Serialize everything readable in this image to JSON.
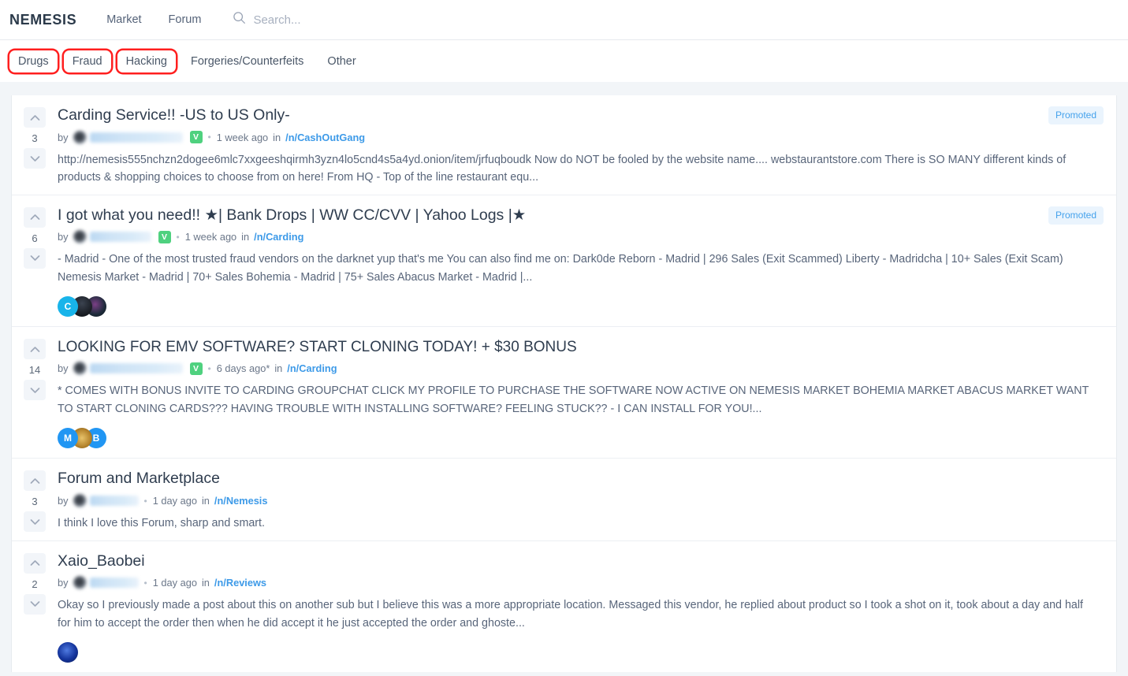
{
  "header": {
    "brand": "NEMESIS",
    "nav": [
      {
        "label": "Market",
        "name": "nav-market"
      },
      {
        "label": "Forum",
        "name": "nav-forum"
      }
    ],
    "search": {
      "placeholder": "Search...",
      "value": "",
      "icon": "search-icon"
    }
  },
  "categories": [
    {
      "label": "Drugs",
      "highlighted": true
    },
    {
      "label": "Fraud",
      "highlighted": true
    },
    {
      "label": "Hacking",
      "highlighted": true
    },
    {
      "label": "Forgeries/Counterfeits",
      "highlighted": false
    },
    {
      "label": "Other",
      "highlighted": false
    }
  ],
  "colors": {
    "accent_link": "#3d9ae8",
    "verified_badge": "#4fd17f",
    "promoted_bg": "#eaf4fd",
    "promoted_text": "#45a2ec",
    "highlight_outline": "#ff1f1f",
    "page_bg": "#f2f5f8"
  },
  "posts": [
    {
      "score": "3",
      "title": "Carding Service!! -US to US Only-",
      "by_label": "by",
      "author_redacted": true,
      "verified": true,
      "verified_label": "V",
      "separator": "•",
      "age": "1 week ago",
      "in_label": "in",
      "sub": "/n/CashOutGang",
      "excerpt": "http://nemesis555nchzn2dogee6mlc7xxgeeshqirmh3yzn4lo5cnd4s5a4yd.onion/item/jrfuqboudk Now do NOT be fooled by the website name.... webstaurantstore.com There is SO MANY different kinds of products & shopping choices to choose from on here! From HQ - Top of the line restaurant equ...",
      "promoted": true,
      "promoted_label": "Promoted",
      "avatars": []
    },
    {
      "score": "6",
      "title": "I got what you need!! ★| Bank Drops | WW CC/CVV | Yahoo Logs |★",
      "by_label": "by",
      "author_redacted": true,
      "verified": true,
      "verified_label": "V",
      "separator": "•",
      "age": "1 week ago",
      "in_label": "in",
      "sub": "/n/Carding",
      "excerpt": "- Madrid - One of the most trusted fraud vendors on the darknet yup that's me You can also find me on: Dark0de Reborn - Madrid | 296 Sales (Exit Scammed) Liberty - Madridcha | 10+ Sales (Exit Scam) Nemesis Market - Madrid | 70+ Sales Bohemia - Madrid | 75+ Sales Abacus Market - Madrid |...",
      "promoted": true,
      "promoted_label": "Promoted",
      "avatars": [
        {
          "letter": "C",
          "style": "cyan"
        },
        {
          "letter": "",
          "style": "dark"
        },
        {
          "letter": "",
          "style": "purple"
        }
      ]
    },
    {
      "score": "14",
      "title": "LOOKING FOR EMV SOFTWARE? START CLONING TODAY! + $30 BONUS",
      "by_label": "by",
      "author_redacted": true,
      "verified": true,
      "verified_label": "V",
      "separator": "•",
      "age": "6 days ago*",
      "in_label": "in",
      "sub": "/n/Carding",
      "excerpt": "* COMES WITH BONUS INVITE TO CARDING GROUPCHAT CLICK MY PROFILE TO PURCHASE THE SOFTWARE NOW ACTIVE ON NEMESIS MARKET BOHEMIA MARKET ABACUS MARKET WANT TO START CLONING CARDS??? HAVING TROUBLE WITH INSTALLING SOFTWARE? FEELING STUCK?? - I CAN INSTALL FOR YOU!...",
      "promoted": false,
      "promoted_label": "",
      "avatars": [
        {
          "letter": "M",
          "style": "blue"
        },
        {
          "letter": "",
          "style": "gold"
        },
        {
          "letter": "B",
          "style": "blue"
        }
      ]
    },
    {
      "score": "3",
      "title": "Forum and Marketplace",
      "by_label": "by",
      "author_redacted": true,
      "verified": false,
      "verified_label": "",
      "separator": "•",
      "age": "1 day ago",
      "in_label": "in",
      "sub": "/n/Nemesis",
      "excerpt": "I think I love this Forum, sharp and smart.",
      "promoted": false,
      "promoted_label": "",
      "avatars": []
    },
    {
      "score": "2",
      "title": "Xaio_Baobei",
      "by_label": "by",
      "author_redacted": true,
      "verified": false,
      "verified_label": "",
      "separator": "•",
      "age": "1 day ago",
      "in_label": "in",
      "sub": "/n/Reviews",
      "excerpt": "Okay so I previously made a post about this on another sub but I believe this was a more appropriate location. Messaged this vendor, he replied about product so I took a shot on it, took about a day and half for him to accept the order then when he did accept it he just accepted the order and ghoste...",
      "promoted": false,
      "promoted_label": "",
      "avatars": [
        {
          "letter": "",
          "style": "royal"
        }
      ]
    }
  ]
}
